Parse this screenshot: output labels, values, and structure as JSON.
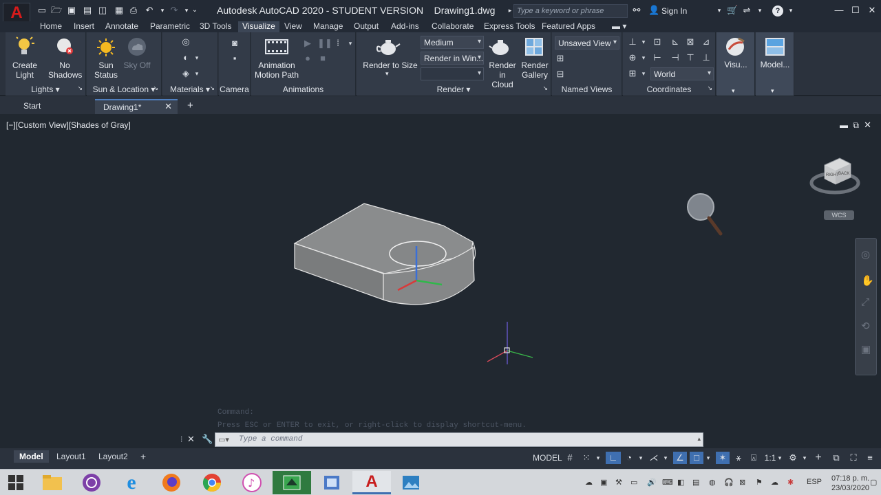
{
  "titlebar": {
    "app_title": "Autodesk AutoCAD 2020 - STUDENT VERSION",
    "doc_name": "Drawing1.dwg",
    "search_placeholder": "Type a keyword or phrase",
    "sign_in": "Sign In"
  },
  "ribbon_tabs": [
    "Home",
    "Insert",
    "Annotate",
    "Parametric",
    "3D Tools",
    "Visualize",
    "View",
    "Manage",
    "Output",
    "Add-ins",
    "Collaborate",
    "Express Tools",
    "Featured Apps"
  ],
  "active_tab": "Visualize",
  "panels": {
    "lights": {
      "title": "Lights",
      "create_light": "Create\nLight",
      "no_shadows": "No\nShadows"
    },
    "sun": {
      "title": "Sun & Location",
      "sun_status": "Sun\nStatus",
      "sky_off": "Sky Off"
    },
    "materials": {
      "title": "Materials"
    },
    "camera": {
      "title": "Camera"
    },
    "animations": {
      "title": "Animations",
      "motion_path": "Animation\nMotion Path"
    },
    "render": {
      "title": "Render",
      "render_to_size": "Render to Size",
      "quality": "Medium",
      "render_in": "Render in Win...",
      "render_cloud": "Render in\nCloud",
      "render_gallery": "Render\nGallery"
    },
    "named_views": {
      "title": "Named Views",
      "view": "Unsaved View"
    },
    "coordinates": {
      "title": "Coordinates",
      "ucs": "World"
    },
    "visual_styles": {
      "label": "Visu..."
    },
    "model_viewports": {
      "label": "Model..."
    }
  },
  "file_tabs": [
    "Start",
    "Drawing1*"
  ],
  "viewport": {
    "label": "[−][Custom View][Shades of Gray]",
    "wcs": "WCS",
    "viewcube_right": "RIGHT",
    "viewcube_back": "BACK"
  },
  "command": {
    "history": [
      "Command:",
      "Press ESC or ENTER to exit, or right-click to display shortcut-menu."
    ],
    "placeholder": "Type a command"
  },
  "layout_tabs": [
    "Model",
    "Layout1",
    "Layout2"
  ],
  "status": {
    "model": "MODEL",
    "scale": "1:1"
  },
  "taskbar": {
    "lang": "ESP",
    "time": "07:18 p. m.",
    "date": "23/03/2020"
  }
}
